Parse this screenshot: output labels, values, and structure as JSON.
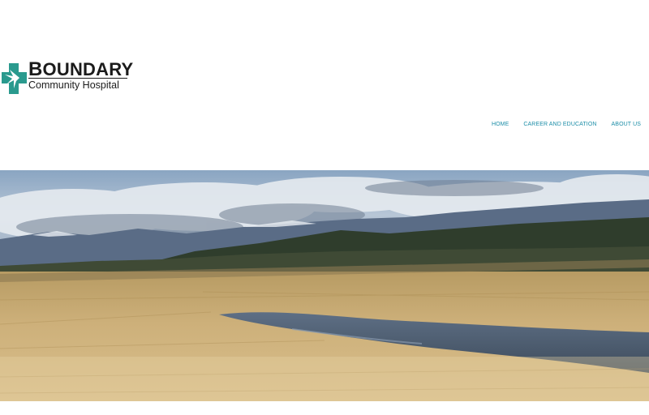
{
  "site": {
    "logo": {
      "title_first": "B",
      "title_rest": "OUNDARY",
      "subtitle": "Community Hospital",
      "mark_color": "#2a9a8e"
    }
  },
  "nav": {
    "items": [
      {
        "label": "HOME"
      },
      {
        "label": "CAREER AND EDUCATION"
      },
      {
        "label": "ABOUT US"
      }
    ],
    "color": "#1d8ea8"
  },
  "hero": {
    "image": "landscape-photo"
  }
}
